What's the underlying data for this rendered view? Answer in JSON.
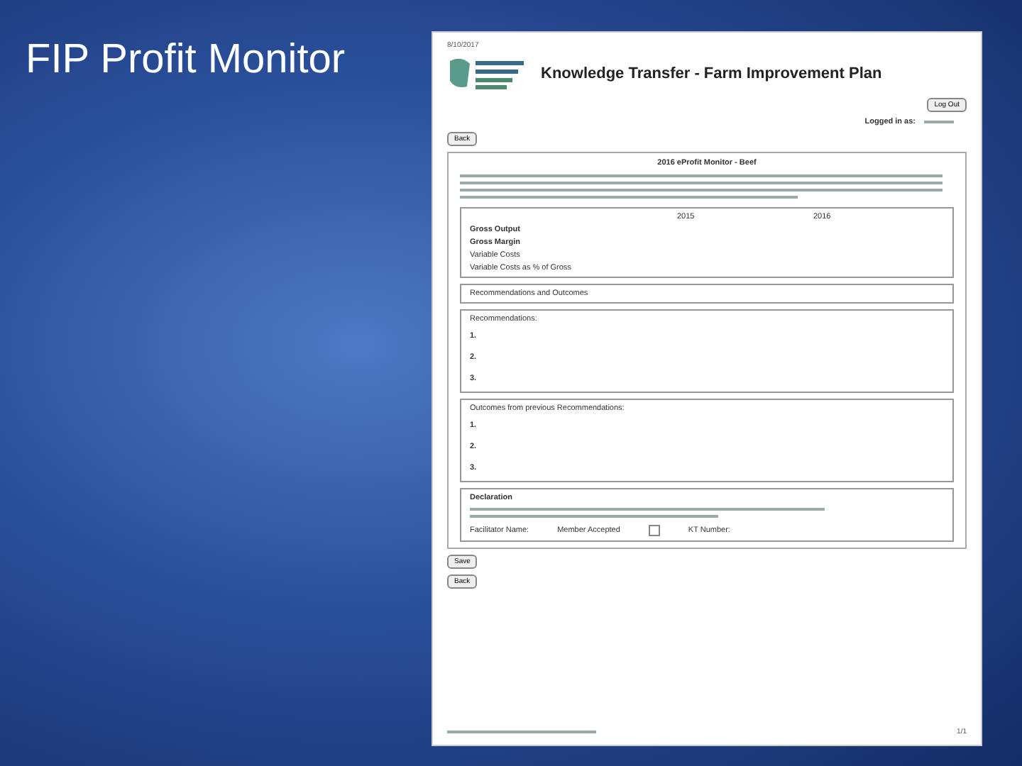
{
  "slide": {
    "title": "FIP Profit Monitor"
  },
  "document": {
    "header_left": "8/10/2017",
    "heading": "Knowledge Transfer - Farm Improvement Plan",
    "logout_button": "Log Out",
    "logged_in": "Logged in as:",
    "back_button": "Back",
    "form_title": "2016 eProfit Monitor - Beef",
    "years": [
      "2015",
      "2016"
    ],
    "metrics": [
      "Gross Output",
      "Gross Margin",
      "Variable Costs",
      "Variable Costs as % of Gross"
    ],
    "recommendations_heading": "Recommendations and Outcomes",
    "sections": [
      {
        "title": "Recommendations:",
        "items": [
          "1.",
          "2.",
          "3."
        ]
      },
      {
        "title": "Outcomes from previous Recommendations:",
        "items": [
          "1.",
          "2.",
          "3."
        ]
      }
    ],
    "declaration": {
      "title": "Declaration",
      "facilitator_label": "Facilitator Name:",
      "member_label": "Member Accepted",
      "member_accepted": false,
      "kt_label": "KT Number:"
    },
    "bottom_buttons": [
      "Save",
      "Back"
    ],
    "page_number": "1/1"
  }
}
